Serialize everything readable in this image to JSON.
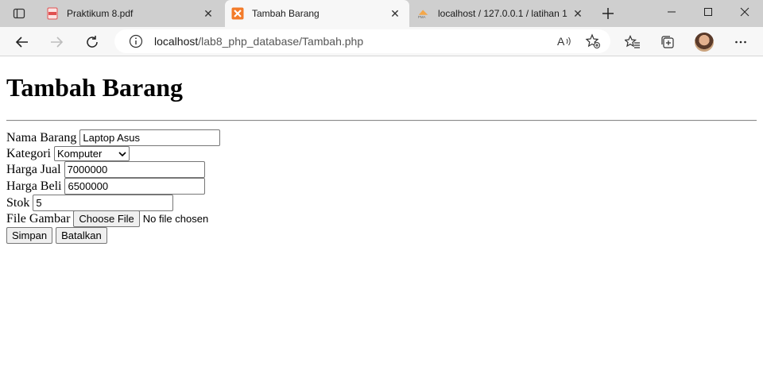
{
  "browser": {
    "tabs": [
      {
        "title": "Praktikum 8.pdf",
        "favicon": "pdf-icon",
        "active": false
      },
      {
        "title": "Tambah Barang",
        "favicon": "xampp-icon",
        "active": true
      },
      {
        "title": "localhost / 127.0.0.1 / latihan 1",
        "favicon": "phpmyadmin-icon",
        "active": false
      }
    ],
    "address": {
      "host": "localhost",
      "path": "/lab8_php_database/Tambah.php"
    },
    "colors": {
      "tabstrip": "#cfcfcf",
      "active_tab": "#f7f7f7",
      "xampp": "#f37b29",
      "pdf": "#e05050"
    }
  },
  "page": {
    "heading": "Tambah Barang",
    "form": {
      "nama_label": "Nama Barang",
      "nama_value": "Laptop Asus",
      "kategori_label": "Kategori",
      "kategori_value": "Komputer",
      "harga_jual_label": "Harga Jual",
      "harga_jual_value": "7000000",
      "harga_beli_label": "Harga Beli",
      "harga_beli_value": "6500000",
      "stok_label": "Stok",
      "stok_value": "5",
      "gambar_label": "File Gambar",
      "choose_file_label": "Choose File",
      "no_file_text": "No file chosen",
      "simpan_label": "Simpan",
      "batalkan_label": "Batalkan"
    }
  }
}
